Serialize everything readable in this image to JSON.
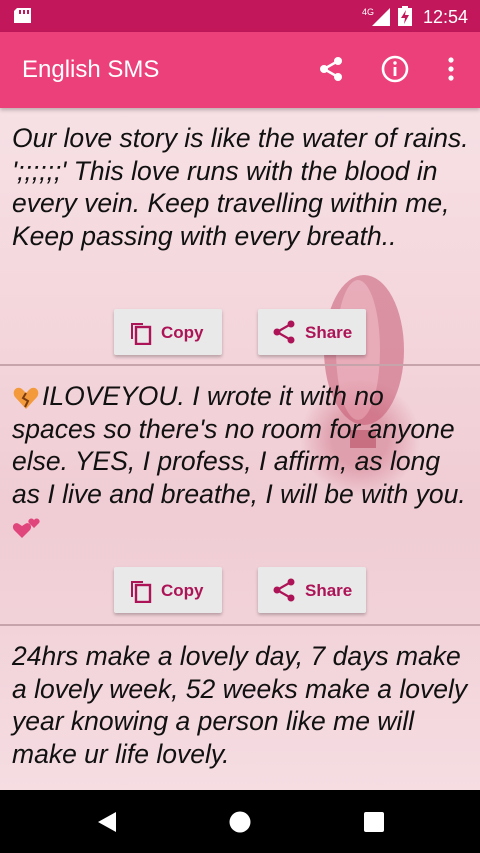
{
  "status": {
    "network": "4G",
    "time": "12:54"
  },
  "app_bar": {
    "title": "English SMS"
  },
  "messages": [
    {
      "text": "Our love story is like the water of rains. ';;;;;;' This love runs with the blood in every vein. Keep travelling within me, Keep passing with every breath.."
    },
    {
      "text": "ILOVEYOU. I wrote it with no spaces so there's no room for anyone else. YES, I profess, I affirm, as long as I live and breathe, I will be with you."
    },
    {
      "text": "24hrs make a lovely day, 7 days make a lovely week, 52 weeks make a lovely year  knowing a person like me will make ur life lovely."
    }
  ],
  "actions": {
    "copy_label": "Copy",
    "share_label": "Share"
  },
  "colors": {
    "status_bar": "#c2185b",
    "app_bar": "#ec407a",
    "accent": "#ad1457"
  }
}
